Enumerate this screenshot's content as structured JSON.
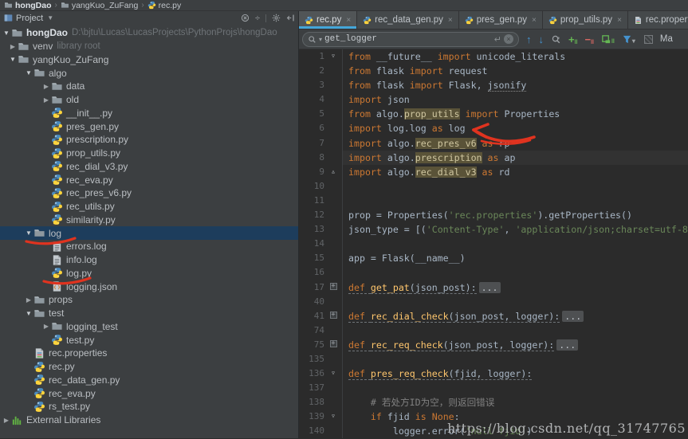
{
  "breadcrumbs": {
    "items": [
      {
        "label": "hongDao",
        "icon": "folder",
        "bold": true
      },
      {
        "label": "yangKuo_ZuFang",
        "icon": "folder",
        "bold": false
      },
      {
        "label": "rec.py",
        "icon": "python",
        "bold": false
      }
    ]
  },
  "project_panel": {
    "title": "Project",
    "tree": [
      {
        "label": "hongDao",
        "secondary": "D:\\bjtu\\Lucas\\LucasProjects\\PythonProjs\\hongDao",
        "icon": "folder",
        "level": 0,
        "state": "expanded",
        "bold": true
      },
      {
        "label": "venv",
        "secondary": "library root",
        "icon": "folder",
        "level": 1,
        "state": "collapsed"
      },
      {
        "label": "yangKuo_ZuFang",
        "icon": "folder",
        "level": 1,
        "state": "expanded"
      },
      {
        "label": "algo",
        "icon": "folder",
        "level": 2,
        "state": "expanded"
      },
      {
        "label": "data",
        "icon": "folder",
        "level": 3,
        "state": "collapsed"
      },
      {
        "label": "old",
        "icon": "folder",
        "level": 3,
        "state": "collapsed"
      },
      {
        "label": "__init__.py",
        "icon": "python",
        "level": 3,
        "state": "file"
      },
      {
        "label": "pres_gen.py",
        "icon": "python",
        "level": 3,
        "state": "file"
      },
      {
        "label": "prescription.py",
        "icon": "python",
        "level": 3,
        "state": "file"
      },
      {
        "label": "prop_utils.py",
        "icon": "python",
        "level": 3,
        "state": "file"
      },
      {
        "label": "rec_dial_v3.py",
        "icon": "python",
        "level": 3,
        "state": "file"
      },
      {
        "label": "rec_eva.py",
        "icon": "python",
        "level": 3,
        "state": "file"
      },
      {
        "label": "rec_pres_v6.py",
        "icon": "python",
        "level": 3,
        "state": "file"
      },
      {
        "label": "rec_utils.py",
        "icon": "python",
        "level": 3,
        "state": "file"
      },
      {
        "label": "similarity.py",
        "icon": "python",
        "level": 3,
        "state": "file"
      },
      {
        "label": "log",
        "icon": "folder",
        "level": 2,
        "state": "expanded",
        "selected": true
      },
      {
        "label": "errors.log",
        "icon": "logfile",
        "level": 3,
        "state": "file"
      },
      {
        "label": "info.log",
        "icon": "logfile",
        "level": 3,
        "state": "file"
      },
      {
        "label": "log.py",
        "icon": "python",
        "level": 3,
        "state": "file"
      },
      {
        "label": "logging.json",
        "icon": "json",
        "level": 3,
        "state": "file"
      },
      {
        "label": "props",
        "icon": "folder",
        "level": 2,
        "state": "collapsed"
      },
      {
        "label": "test",
        "icon": "folder",
        "level": 2,
        "state": "expanded"
      },
      {
        "label": "logging_test",
        "icon": "folder",
        "level": 3,
        "state": "collapsed"
      },
      {
        "label": "test.py",
        "icon": "python",
        "level": 3,
        "state": "file"
      },
      {
        "label": "rec.properties",
        "icon": "props",
        "level": 2,
        "state": "file"
      },
      {
        "label": "rec.py",
        "icon": "python",
        "level": 2,
        "state": "file"
      },
      {
        "label": "rec_data_gen.py",
        "icon": "python",
        "level": 2,
        "state": "file"
      },
      {
        "label": "rec_eva.py",
        "icon": "python",
        "level": 2,
        "state": "file"
      },
      {
        "label": "rs_test.py",
        "icon": "python",
        "level": 2,
        "state": "file"
      },
      {
        "label": "External Libraries",
        "icon": "extlib",
        "level": 0,
        "state": "collapsed"
      }
    ]
  },
  "editor": {
    "tabs": [
      {
        "label": "rec.py",
        "icon": "python",
        "active": true
      },
      {
        "label": "rec_data_gen.py",
        "icon": "python",
        "active": false
      },
      {
        "label": "pres_gen.py",
        "icon": "python",
        "active": false
      },
      {
        "label": "prop_utils.py",
        "icon": "python",
        "active": false
      },
      {
        "label": "rec.properties",
        "icon": "props",
        "active": false
      }
    ],
    "search": {
      "value": "get_logger",
      "match_label": "Ma"
    },
    "code": {
      "lines": [
        {
          "num": 1,
          "fold": "d",
          "segs": [
            [
              "kw",
              "from"
            ],
            [
              "pl",
              " __future__ "
            ],
            [
              "kw",
              "import"
            ],
            [
              "pl",
              " unicode_literals"
            ]
          ]
        },
        {
          "num": 2,
          "segs": [
            [
              "kw",
              "from"
            ],
            [
              "pl",
              " flask "
            ],
            [
              "kw",
              "import"
            ],
            [
              "pl",
              " request"
            ]
          ]
        },
        {
          "num": 3,
          "segs": [
            [
              "kw",
              "from"
            ],
            [
              "pl",
              " flask "
            ],
            [
              "kw",
              "import"
            ],
            [
              "pl",
              " Flask, "
            ],
            [
              "pl",
              "jsonify",
              "dot"
            ]
          ]
        },
        {
          "num": 4,
          "segs": [
            [
              "kw",
              "import"
            ],
            [
              "pl",
              " json"
            ]
          ]
        },
        {
          "num": 5,
          "segs": [
            [
              "kw",
              "from"
            ],
            [
              "pl",
              " algo."
            ],
            [
              "pl",
              "prop_utils",
              "h"
            ],
            [
              "pl",
              " "
            ],
            [
              "kw",
              "import"
            ],
            [
              "pl",
              " Properties"
            ]
          ]
        },
        {
          "num": 6,
          "segs": [
            [
              "kw",
              "import"
            ],
            [
              "pl",
              " log.log "
            ],
            [
              "kw",
              "as"
            ],
            [
              "pl",
              " log"
            ]
          ]
        },
        {
          "num": 7,
          "segs": [
            [
              "kw",
              "import"
            ],
            [
              "pl",
              " algo."
            ],
            [
              "pl",
              "rec_pres_v6",
              "h"
            ],
            [
              "pl",
              " "
            ],
            [
              "kw",
              "as"
            ],
            [
              "pl",
              " rp"
            ]
          ]
        },
        {
          "num": 8,
          "caret": true,
          "segs": [
            [
              "kw",
              "import"
            ],
            [
              "pl",
              " algo."
            ],
            [
              "pl",
              "prescription",
              "h"
            ],
            [
              "pl",
              " "
            ],
            [
              "kw",
              "as"
            ],
            [
              "pl",
              " ap"
            ]
          ]
        },
        {
          "num": 9,
          "fold": "u",
          "segs": [
            [
              "kw",
              "import"
            ],
            [
              "pl",
              " algo."
            ],
            [
              "pl",
              "rec_dial_v3",
              "h"
            ],
            [
              "pl",
              " "
            ],
            [
              "kw",
              "as"
            ],
            [
              "pl",
              " rd"
            ]
          ]
        },
        {
          "num": 10,
          "segs": []
        },
        {
          "num": 11,
          "segs": []
        },
        {
          "num": 12,
          "segs": [
            [
              "pl",
              "prop = Properties("
            ],
            [
              "st",
              "'rec.properties'"
            ],
            [
              "pl",
              ").getProperties()"
            ]
          ]
        },
        {
          "num": 13,
          "segs": [
            [
              "pl",
              "json_type = [("
            ],
            [
              "st",
              "'Content-Type'"
            ],
            [
              "pl",
              ", "
            ],
            [
              "st",
              "'application/json;charset=utf-8'"
            ],
            [
              "pl",
              ")]"
            ]
          ]
        },
        {
          "num": 14,
          "segs": []
        },
        {
          "num": 15,
          "segs": [
            [
              "pl",
              "app = Flask(__name__)"
            ]
          ]
        },
        {
          "num": 16,
          "segs": []
        },
        {
          "num": 17,
          "fold": "p",
          "segs": [
            [
              "kw",
              "def ",
              "u"
            ],
            [
              "fn",
              "get_pat",
              "u"
            ],
            [
              "pl",
              "(json_post):",
              "u"
            ],
            [
              "pl",
              "...",
              "chip"
            ]
          ]
        },
        {
          "num": 40,
          "segs": []
        },
        {
          "num": 41,
          "fold": "p",
          "segs": [
            [
              "kw",
              "def ",
              "u"
            ],
            [
              "fn",
              "rec_dial_check",
              "u"
            ],
            [
              "pl",
              "(json_post, logger):",
              "u"
            ],
            [
              "pl",
              "...",
              "chip"
            ]
          ]
        },
        {
          "num": 74,
          "segs": []
        },
        {
          "num": 75,
          "fold": "p",
          "segs": [
            [
              "kw",
              "def ",
              "u"
            ],
            [
              "fn",
              "rec_req_check",
              "u"
            ],
            [
              "pl",
              "(json_post, logger):",
              "u"
            ],
            [
              "pl",
              "...",
              "chip"
            ]
          ]
        },
        {
          "num": 135,
          "segs": []
        },
        {
          "num": 136,
          "fold": "d",
          "segs": [
            [
              "kw",
              "def ",
              "u"
            ],
            [
              "fn",
              "pres_req_check",
              "u"
            ],
            [
              "pl",
              "(fjid, logger):",
              "u"
            ]
          ]
        },
        {
          "num": 137,
          "segs": []
        },
        {
          "num": 138,
          "segs": [
            [
              "cm",
              "    # 若处方ID为空，则返回错误"
            ]
          ]
        },
        {
          "num": 139,
          "fold": "d",
          "segs": [
            [
              "kw",
              "    if"
            ],
            [
              "pl",
              " fjid "
            ],
            [
              "kw",
              "is"
            ],
            [
              "kw",
              " None"
            ],
            [
              "pl",
              ":"
            ]
          ]
        },
        {
          "num": 140,
          "segs": [
            [
              "pl",
              "        logger.error("
            ],
            [
              "st",
              "'null fjid'"
            ],
            [
              "pl",
              ")"
            ]
          ]
        }
      ]
    }
  },
  "annotations": {
    "color": "#e0331f"
  },
  "watermark": {
    "text": "https://blog.csdn.net/qq_31747765"
  }
}
